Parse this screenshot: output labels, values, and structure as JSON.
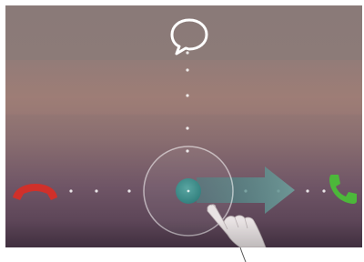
{
  "lock_screen": {
    "message_action": {
      "icon": "speech-bubble-icon",
      "color": "#ffffff"
    },
    "decline_action": {
      "icon": "phone-hangup-icon",
      "color": "#d0302a"
    },
    "answer_action": {
      "icon": "phone-answer-icon",
      "color": "#4cb83a"
    },
    "unlock_handle": {
      "icon": "swipe-handle-icon",
      "color": "#3f8f8c"
    },
    "swipe_hint": {
      "icon": "arrow-right-icon",
      "color": "#5f8f8c"
    },
    "gesture_hand": {
      "icon": "pointing-hand-icon",
      "color": "#e8e0e0"
    }
  }
}
